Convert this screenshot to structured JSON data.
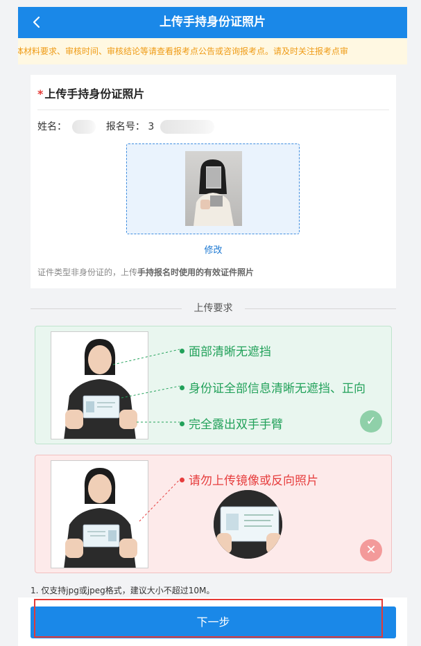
{
  "header": {
    "title": "上传手持身份证照片",
    "back_icon": "back-arrow-icon"
  },
  "notice": {
    "text": "具体材料要求、审核时间、审核结论等请查看报考点公告或咨询报考点。请及时关注报考点审"
  },
  "upload_card": {
    "title": "上传手持身份证照片",
    "required_mark": "*",
    "name_label": "姓名：",
    "reg_label": "报名号：",
    "reg_value_visible": "3",
    "modify_label": "修改",
    "hint_prefix": "证件类型非身份证的，上传",
    "hint_bold": "手持报名时使用的有效证件照片"
  },
  "requirements": {
    "title": "上传要求",
    "good": {
      "points": [
        "面部清晰无遮挡",
        "身份证全部信息清晰无遮挡、正向",
        "完全露出双手手臂"
      ],
      "badge_symbol": "✓",
      "badge_color": "#8fd0a9"
    },
    "bad": {
      "point": "请勿上传镜像或反向照片",
      "badge_symbol": "✕",
      "badge_color": "#f39a9a"
    }
  },
  "footer": {
    "note": "1. 仅支持jpg或jpeg格式，建议大小不超过10M。",
    "next_label": "下一步"
  },
  "colors": {
    "primary": "#1a88e8",
    "success": "#22a15a",
    "danger": "#e63d3d",
    "warning": "#ef9b16"
  }
}
